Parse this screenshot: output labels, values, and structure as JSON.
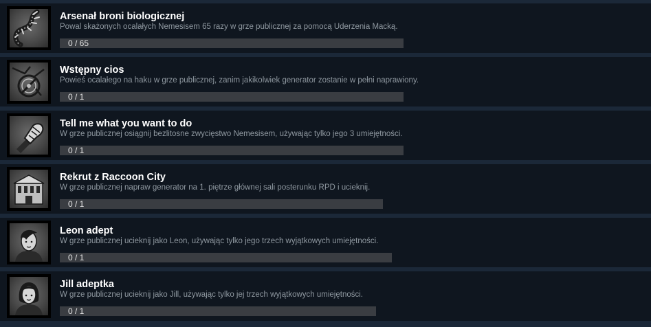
{
  "achievements": [
    {
      "title": "Arsenał broni biologicznej",
      "description": "Powal skażonych ocalałych Nemesisem 65 razy w grze publicznej za pomocą Uderzenia Macką.",
      "progress_text": "0 / 65",
      "progress": 0,
      "icon": "tentacle-icon"
    },
    {
      "title": "Wstępny cios",
      "description": "Powieś ocalałego na haku w grze publicznej, zanim jakikolwiek generator zostanie w pełni naprawiony.",
      "progress_text": "0 / 1",
      "progress": 0,
      "icon": "biohazard-fist-icon"
    },
    {
      "title": "Tell me what you want to do",
      "description": "W grze publicznej osiągnij bezlitosne zwycięstwo Nemesisem, używając tylko jego 3 umiejętności.",
      "progress_text": "0 / 1",
      "progress": 0,
      "icon": "gauntlet-icon"
    },
    {
      "title": "Rekrut z Raccoon City",
      "description": "W grze publicznej napraw generator na 1. piętrze głównej sali posterunku RPD i ucieknij.",
      "progress_text": "0 / 1",
      "progress": 0,
      "icon": "police-station-icon"
    },
    {
      "title": "Leon adept",
      "description": "W grze publicznej ucieknij jako Leon, używając tylko jego trzech wyjątkowych umiejętności.",
      "progress_text": "0 / 1",
      "progress": 0,
      "icon": "leon-portrait-icon"
    },
    {
      "title": "Jill adeptka",
      "description": "W grze publicznej ucieknij jako Jill, używając tylko jej trzech wyjątkowych umiejętności.",
      "progress_text": "0 / 1",
      "progress": 0,
      "icon": "jill-portrait-icon"
    }
  ]
}
